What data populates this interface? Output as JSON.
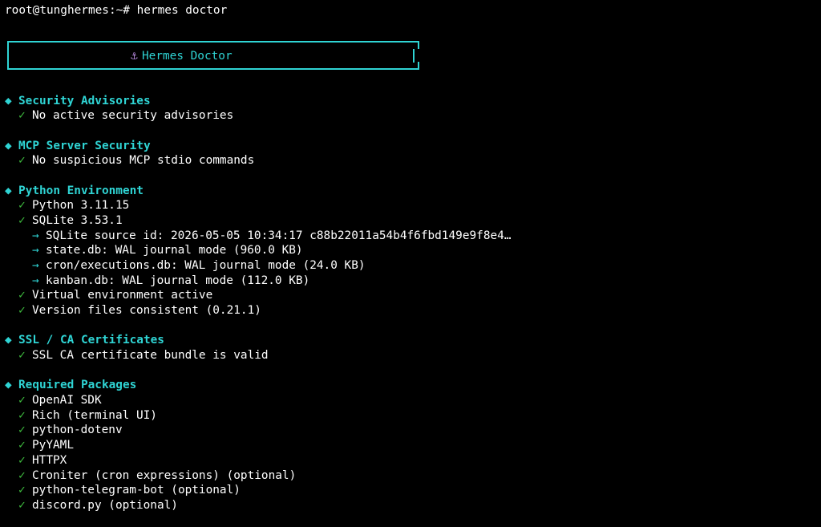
{
  "terminal": {
    "prompt": "root@tunghermes:~# ",
    "command": "hermes doctor"
  },
  "banner": {
    "icon": "anchor-icon",
    "title": "Hermes Doctor"
  },
  "glyphs": {
    "diamond": "◆",
    "check": "✓",
    "arrow": "→",
    "anchor": "⚓"
  },
  "sections": [
    {
      "title": "Security Advisories",
      "items": [
        {
          "kind": "check",
          "text": "No active security advisories"
        }
      ]
    },
    {
      "title": "MCP Server Security",
      "items": [
        {
          "kind": "check",
          "text": "No suspicious MCP stdio commands"
        }
      ]
    },
    {
      "title": "Python Environment",
      "items": [
        {
          "kind": "check",
          "text": "Python 3.11.15"
        },
        {
          "kind": "check",
          "text": "SQLite 3.53.1"
        },
        {
          "kind": "arrow",
          "text": "SQLite source id: 2026-05-05 10:34:17 c88b22011a54b4f6fbd149e9f8e4…"
        },
        {
          "kind": "arrow",
          "text": "state.db: WAL journal mode (960.0 KB)"
        },
        {
          "kind": "arrow",
          "text": "cron/executions.db: WAL journal mode (24.0 KB)"
        },
        {
          "kind": "arrow",
          "text": "kanban.db: WAL journal mode (112.0 KB)"
        },
        {
          "kind": "check",
          "text": "Virtual environment active"
        },
        {
          "kind": "check",
          "text": "Version files consistent (0.21.1)"
        }
      ]
    },
    {
      "title": "SSL / CA Certificates",
      "items": [
        {
          "kind": "check",
          "text": "SSL CA certificate bundle is valid"
        }
      ]
    },
    {
      "title": "Required Packages",
      "items": [
        {
          "kind": "check",
          "text": "OpenAI SDK"
        },
        {
          "kind": "check",
          "text": "Rich (terminal UI)"
        },
        {
          "kind": "check",
          "text": "python-dotenv"
        },
        {
          "kind": "check",
          "text": "PyYAML"
        },
        {
          "kind": "check",
          "text": "HTTPX"
        },
        {
          "kind": "check",
          "text": "Croniter (cron expressions) (optional)"
        },
        {
          "kind": "check",
          "text": "python-telegram-bot (optional)"
        },
        {
          "kind": "check",
          "text": "discord.py (optional)"
        }
      ]
    }
  ],
  "colors": {
    "background": "#000000",
    "text": "#ffffff",
    "accent": "#2fd4d4",
    "check": "#3fbf3f",
    "icon": "#b98be0"
  }
}
